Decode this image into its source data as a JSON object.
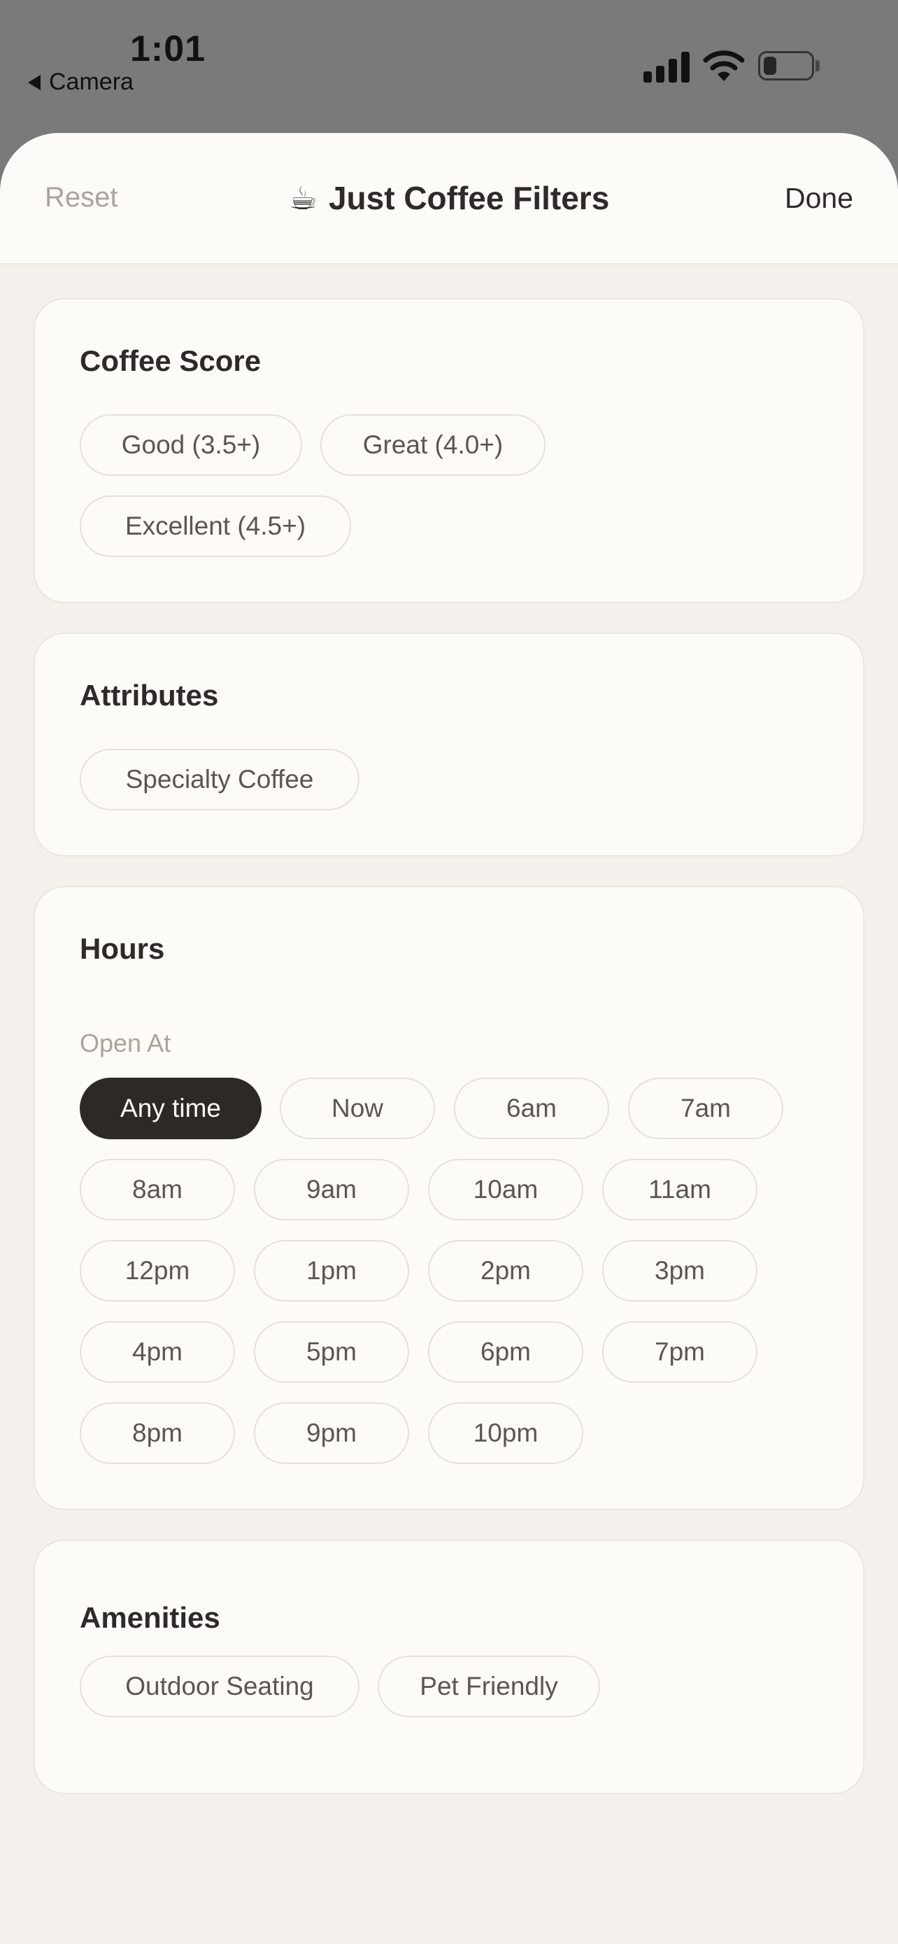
{
  "status_bar": {
    "time": "1:01",
    "back_app": "Camera"
  },
  "header": {
    "reset_label": "Reset",
    "title_icon": "☕",
    "title": "Just Coffee Filters",
    "done_label": "Done"
  },
  "coffee_score": {
    "title": "Coffee Score",
    "options": [
      "Good (3.5+)",
      "Great (4.0+)",
      "Excellent (4.5+)"
    ]
  },
  "attributes": {
    "title": "Attributes",
    "options": [
      "Specialty Coffee"
    ]
  },
  "hours": {
    "title": "Hours",
    "open_at_label": "Open At",
    "selected": "Any time",
    "options": [
      "Any time",
      "Now",
      "6am",
      "7am",
      "8am",
      "9am",
      "10am",
      "11am",
      "12pm",
      "1pm",
      "2pm",
      "3pm",
      "4pm",
      "5pm",
      "6pm",
      "7pm",
      "8pm",
      "9pm",
      "10pm"
    ]
  },
  "amenities": {
    "title": "Amenities",
    "options": [
      "Outdoor Seating",
      "Pet Friendly"
    ]
  },
  "colors": {
    "selected_chip": "#2d2a26",
    "background": "#f4f0eb",
    "card": "#fcfbf8",
    "muted_text": "#aba49b"
  }
}
